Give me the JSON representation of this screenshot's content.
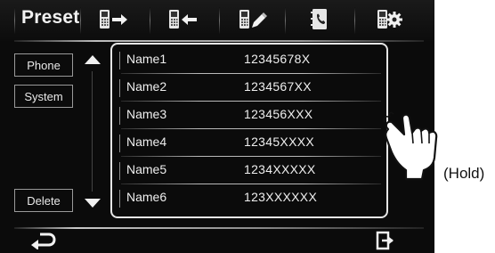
{
  "header": {
    "title": "Preset",
    "tools": [
      {
        "icon": "phone-export-icon"
      },
      {
        "icon": "phone-import-icon"
      },
      {
        "icon": "phone-edit-icon"
      },
      {
        "icon": "phonebook-icon"
      },
      {
        "icon": "phone-settings-icon"
      }
    ]
  },
  "sidebar": {
    "phone_label": "Phone",
    "system_label": "System",
    "delete_label": "Delete"
  },
  "list": {
    "rows": [
      {
        "name": "Name1",
        "number": "12345678X"
      },
      {
        "name": "Name2",
        "number": "1234567XX"
      },
      {
        "name": "Name3",
        "number": "123456XXX"
      },
      {
        "name": "Name4",
        "number": "12345XXXX"
      },
      {
        "name": "Name5",
        "number": "1234XXXXX"
      },
      {
        "name": "Name6",
        "number": "123XXXXXX"
      }
    ]
  },
  "footer": {
    "back_icon": "back-arrow-icon",
    "exit_icon": "exit-icon"
  },
  "annotation": {
    "hold_label": "(Hold)"
  }
}
